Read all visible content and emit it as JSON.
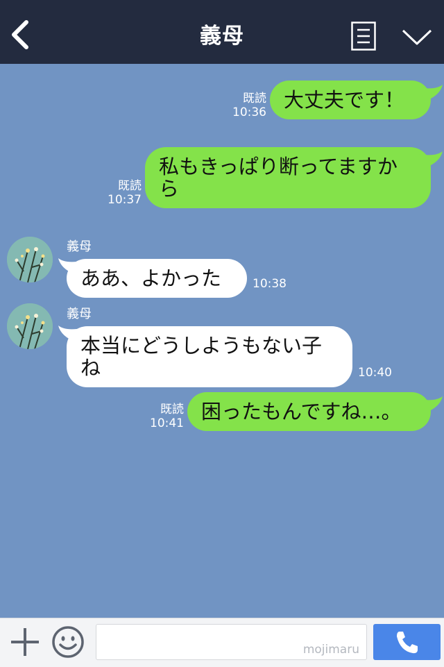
{
  "header": {
    "title": "義母"
  },
  "messages": [
    {
      "id": 1,
      "type": "sent",
      "text": "大丈夫です！",
      "read": "既読",
      "time": "10:36"
    },
    {
      "id": 2,
      "type": "sent",
      "text_line1": "私もきっぱり断ってますか",
      "text_line2": "ら",
      "read": "既読",
      "time": "10:37"
    },
    {
      "id": 3,
      "type": "received",
      "sender": "義母",
      "text": "ああ、よかった",
      "time": "10:38"
    },
    {
      "id": 4,
      "type": "received",
      "sender": "義母",
      "text_line1": "本当にどうしようもない子",
      "text_line2": "ね",
      "time": "10:40"
    },
    {
      "id": 5,
      "type": "sent",
      "text": "困ったもんですね…。",
      "read": "既読",
      "time": "10:41"
    }
  ],
  "footer": {
    "input_value": "",
    "watermark": "mojimaru"
  },
  "colors": {
    "header_bg": "#232b3f",
    "chat_bg": "#7194c3",
    "sent_bubble": "#84e24a",
    "received_bubble": "#ffffff",
    "call_button": "#4a86e8"
  },
  "icons": [
    "back-icon",
    "menu-icon",
    "chevron-down-icon",
    "plus-icon",
    "smile-icon",
    "phone-icon",
    "avatar"
  ]
}
